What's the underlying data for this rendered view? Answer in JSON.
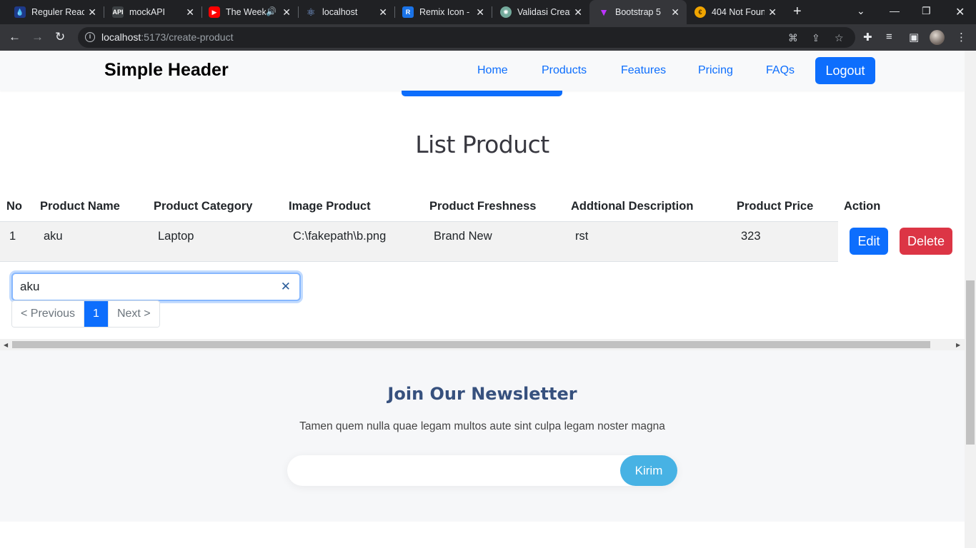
{
  "browser": {
    "tabs": [
      {
        "title": "Reguler React",
        "favicon": "drop-icon",
        "color": "#3b5bdb"
      },
      {
        "title": "mockAPI",
        "favicon": "api-icon",
        "color": "#3c4043"
      },
      {
        "title": "The Weekn",
        "favicon": "youtube-icon",
        "color": "#ff0000"
      },
      {
        "title": "localhost",
        "favicon": "react-icon",
        "color": "#3c4043"
      },
      {
        "title": "Remix Icon - C",
        "favicon": "remix-icon",
        "color": "#1a73e8"
      },
      {
        "title": "Validasi Creat",
        "favicon": "chatgpt-icon",
        "color": "#74aa9c"
      },
      {
        "title": "Bootstrap 5",
        "favicon": "vite-icon",
        "color": "#8a63d2",
        "active": true
      },
      {
        "title": "404 Not Foun",
        "favicon": "euro-icon",
        "color": "#f0a500"
      }
    ],
    "url_host": "localhost",
    "url_path": ":5173/create-product"
  },
  "header": {
    "brand": "Simple Header",
    "nav": [
      "Home",
      "Products",
      "Features",
      "Pricing",
      "FAQs"
    ],
    "logout": "Logout"
  },
  "list": {
    "title": "List Product",
    "columns": [
      "No",
      "Product Name",
      "Product Category",
      "Image Product",
      "Product Freshness",
      "Addtional Description",
      "Product Price",
      "Action"
    ],
    "rows": [
      {
        "no": "1",
        "name": "aku",
        "category": "Laptop",
        "image": "C:\\fakepath\\b.png",
        "freshness": "Brand New",
        "description": "rst",
        "price": "323",
        "edit": "Edit",
        "delete": "Delete"
      }
    ],
    "search_value": "aku",
    "pagination": {
      "previous": "< Previous",
      "current": "1",
      "next": "Next >"
    }
  },
  "newsletter": {
    "title": "Join Our Newsletter",
    "text": "Tamen quem nulla quae legam multos aute sint culpa legam noster magna",
    "button": "Kirim"
  },
  "colors": {
    "primary": "#0d6efd",
    "danger": "#dc3545",
    "newsletter_title": "#37517e",
    "newsletter_button": "#47b2e4"
  }
}
